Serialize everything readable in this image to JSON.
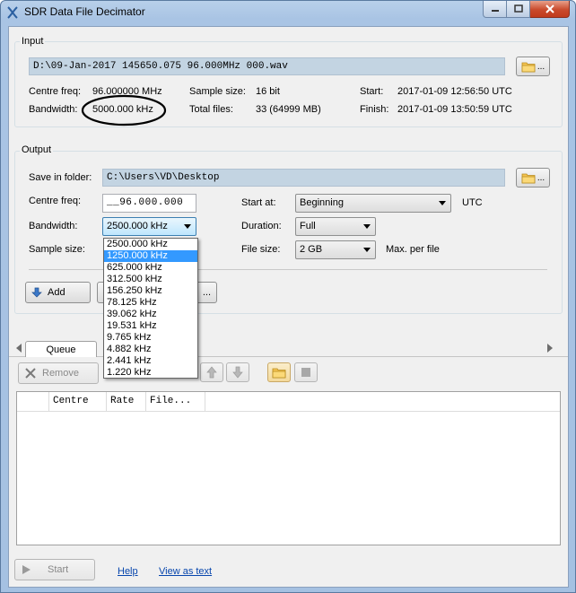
{
  "window": {
    "title": "SDR Data File Decimator"
  },
  "input": {
    "group_title": "Input",
    "file_path": "D:\\09-Jan-2017 145650.075 96.000MHz 000.wav",
    "centre_freq_label": "Centre freq:",
    "centre_freq_value": "96.000000 MHz",
    "bandwidth_label": "Bandwidth:",
    "bandwidth_value": "5000.000 kHz",
    "sample_size_label": "Sample size:",
    "sample_size_value": "16 bit",
    "total_files_label": "Total files:",
    "total_files_value": "33 (64999 MB)",
    "start_label": "Start:",
    "start_value": "2017-01-09 12:56:50 UTC",
    "finish_label": "Finish:",
    "finish_value": "2017-01-09 13:50:59 UTC",
    "browse_label": "..."
  },
  "output": {
    "group_title": "Output",
    "save_folder_label": "Save in folder:",
    "save_folder_value": "C:\\Users\\VD\\Desktop",
    "browse_label": "...",
    "centre_freq_label": "Centre freq:",
    "centre_freq_value": "__96.000.000",
    "bandwidth_label": "Bandwidth:",
    "bandwidth_value": "2500.000 kHz",
    "sample_size_label": "Sample size:",
    "start_at_label": "Start at:",
    "start_at_value": "Beginning",
    "utc_label": "UTC",
    "duration_label": "Duration:",
    "duration_value": "Full",
    "file_size_label": "File size:",
    "file_size_value": "2 GB",
    "max_per_file_label": "Max. per file",
    "add_button": "Add",
    "hidden_button": "..."
  },
  "bandwidth_options": [
    "2500.000 kHz",
    "1250.000 kHz",
    "625.000 kHz",
    "312.500 kHz",
    "156.250 kHz",
    "78.125 kHz",
    "39.062 kHz",
    "19.531 kHz",
    "9.765 kHz",
    "4.882 kHz",
    "2.441 kHz",
    "1.220 kHz"
  ],
  "bandwidth_selected_index": 1,
  "queue": {
    "tab_label": "Queue",
    "remove_button": "Remove",
    "columns": [
      "",
      "Centre",
      "Rate",
      "File..."
    ]
  },
  "footer": {
    "start_button": "Start",
    "help_link": "Help",
    "view_as_text_link": "View as text"
  }
}
